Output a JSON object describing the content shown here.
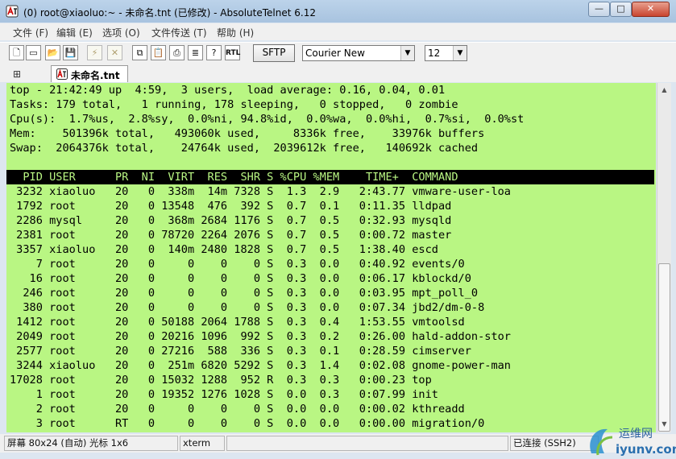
{
  "window": {
    "title": "(0) root@xiaoluo:~ - 未命名.tnt (已修改) - AbsoluteTelnet 6.12",
    "controls": {
      "minimize": "—",
      "maximize": "□",
      "close": "✕"
    }
  },
  "menu": {
    "items": [
      {
        "label": "文件 (F)"
      },
      {
        "label": "编辑 (E)"
      },
      {
        "label": "选项 (O)"
      },
      {
        "label": "文件传送 (T)"
      },
      {
        "label": "帮助 (H)"
      }
    ]
  },
  "toolbar": {
    "sftp_label": "SFTP",
    "font_value": "Courier New",
    "font_size_value": "12"
  },
  "tab": {
    "label": "未命名.tnt"
  },
  "terminal": {
    "lines": [
      "top - 21:42:49 up  4:59,  3 users,  load average: 0.16, 0.04, 0.01",
      "Tasks: 179 total,   1 running, 178 sleeping,   0 stopped,   0 zombie",
      "Cpu(s):  1.7%us,  2.8%sy,  0.0%ni, 94.8%id,  0.0%wa,  0.0%hi,  0.7%si,  0.0%st",
      "Mem:    501396k total,   493060k used,     8336k free,    33976k buffers",
      "Swap:  2064376k total,    24764k used,  2039612k free,   140692k cached"
    ],
    "header": "  PID USER      PR  NI  VIRT  RES  SHR S %CPU %MEM    TIME+  COMMAND",
    "processes": [
      " 3232 xiaoluo   20   0  338m  14m 7328 S  1.3  2.9   2:43.77 vmware-user-loa",
      " 1792 root      20   0 13548  476  392 S  0.7  0.1   0:11.35 lldpad",
      " 2286 mysql     20   0  368m 2684 1176 S  0.7  0.5   0:32.93 mysqld",
      " 2381 root      20   0 78720 2264 2076 S  0.7  0.5   0:00.72 master",
      " 3357 xiaoluo   20   0  140m 2480 1828 S  0.7  0.5   1:38.40 escd",
      "    7 root      20   0     0    0    0 S  0.3  0.0   0:40.92 events/0",
      "   16 root      20   0     0    0    0 S  0.3  0.0   0:06.17 kblockd/0",
      "  246 root      20   0     0    0    0 S  0.3  0.0   0:03.95 mpt_poll_0",
      "  380 root      20   0     0    0    0 S  0.3  0.0   0:07.34 jbd2/dm-0-8",
      " 1412 root      20   0 50188 2064 1788 S  0.3  0.4   1:53.55 vmtoolsd",
      " 2049 root      20   0 20216 1096  992 S  0.3  0.2   0:26.00 hald-addon-stor",
      " 2577 root      20   0 27216  588  336 S  0.3  0.1   0:28.59 cimserver",
      " 3244 xiaoluo   20   0  251m 6820 5292 S  0.3  1.4   0:02.08 gnome-power-man",
      "17028 root      20   0 15032 1288  952 R  0.3  0.3   0:00.23 top",
      "    1 root      20   0 19352 1276 1028 S  0.0  0.3   0:07.99 init",
      "    2 root      20   0     0    0    0 S  0.0  0.0   0:00.02 kthreadd",
      "    3 root      RT   0     0    0    0 S  0.0  0.0   0:00.00 migration/0"
    ]
  },
  "statusbar": {
    "screen": "屏幕 80x24 (自动) 光标 1x6",
    "term_type": "xterm",
    "connection": "已连接 (SSH2)"
  },
  "watermark": {
    "line1": "运维网",
    "line2": "iyunv.com"
  },
  "colors": {
    "terminal_bg": "#b9f683",
    "terminal_fg": "#000000",
    "header_bg": "#000000"
  }
}
